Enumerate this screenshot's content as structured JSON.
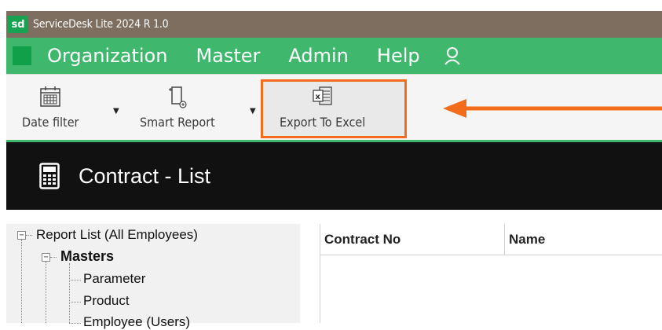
{
  "window": {
    "logo_text": "sd",
    "title": "ServiceDesk Lite 2024 R 1.0"
  },
  "menu": {
    "items": [
      "Organization",
      "Master",
      "Admin",
      "Help"
    ],
    "user_icon": "user-icon"
  },
  "toolbar": {
    "date_filter_label": "Date filter",
    "smart_report_label": "Smart Report",
    "export_label": "Export To Excel",
    "icons": [
      "calendar-icon",
      "report-icon",
      "excel-icon"
    ]
  },
  "header": {
    "title": "Contract - List",
    "icon": "calculator-icon"
  },
  "tree": {
    "root": "Report List (All Employees)",
    "group": "Masters",
    "items": [
      "Parameter",
      "Product",
      "Employee (Users)"
    ]
  },
  "grid": {
    "columns": [
      "Contract No",
      "Name"
    ]
  },
  "colors": {
    "titlebar": "#7d6e5f",
    "menubar": "#3fb86d",
    "highlight": "#f26d1b",
    "header": "#111111"
  }
}
